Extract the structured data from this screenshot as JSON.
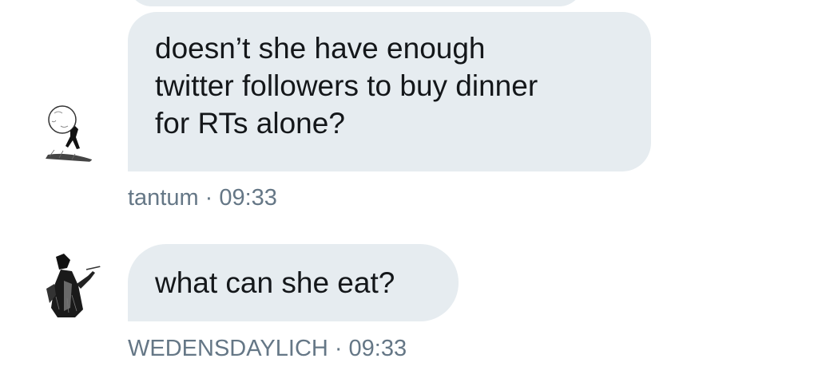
{
  "conversation": {
    "messages": [
      {
        "lines": [
          "doesn’t she have enough",
          "twitter followers to buy dinner",
          "for RTs alone?"
        ],
        "sender": "tantum",
        "time": "09:33",
        "avatar_icon": "sisyphus-boulder-avatar-icon"
      },
      {
        "lines": [
          "what can she eat?"
        ],
        "sender": "WEDENSDAYLICH",
        "time": "09:33",
        "avatar_icon": "lich-wizard-avatar-icon"
      }
    ],
    "separator": "·"
  },
  "colors": {
    "bubble_background": "#e6ecf0",
    "message_text": "#14171a",
    "meta_text": "#657786",
    "page_background": "#ffffff"
  }
}
